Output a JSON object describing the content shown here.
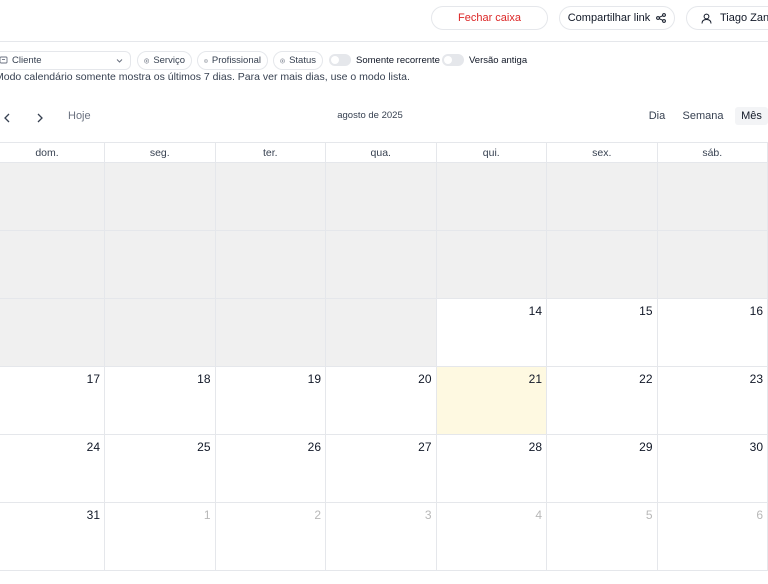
{
  "topbar": {
    "close_register": "Fechar caixa",
    "share_link": "Compartilhar link",
    "user_name": "Tiago Zanon"
  },
  "filters": {
    "client": "Cliente",
    "service": "Serviço",
    "professional": "Profissional",
    "status": "Status",
    "recurring_only": "Somente recorrente",
    "old_version": "Versão antiga"
  },
  "notice": "Modo calendário somente mostra os últimos 7 dias. Para ver mais dias, use o modo lista.",
  "nav": {
    "today": "Hoje",
    "month_title": "agosto de 2025",
    "views": [
      "Dia",
      "Semana",
      "Mês"
    ],
    "active_view": "Mês"
  },
  "calendar": {
    "weekdays": [
      "dom.",
      "seg.",
      "ter.",
      "qua.",
      "qui.",
      "sex.",
      "sáb."
    ],
    "weeks": [
      [
        {
          "n": "",
          "s": "disabled"
        },
        {
          "n": "",
          "s": "disabled"
        },
        {
          "n": "",
          "s": "disabled"
        },
        {
          "n": "",
          "s": "disabled"
        },
        {
          "n": "",
          "s": "disabled"
        },
        {
          "n": "",
          "s": "disabled"
        },
        {
          "n": "",
          "s": "disabled"
        }
      ],
      [
        {
          "n": "",
          "s": "disabled"
        },
        {
          "n": "",
          "s": "disabled"
        },
        {
          "n": "",
          "s": "disabled"
        },
        {
          "n": "",
          "s": "disabled"
        },
        {
          "n": "",
          "s": "disabled"
        },
        {
          "n": "",
          "s": "disabled"
        },
        {
          "n": "",
          "s": "disabled"
        }
      ],
      [
        {
          "n": "",
          "s": "disabled"
        },
        {
          "n": "",
          "s": "disabled"
        },
        {
          "n": "",
          "s": "disabled"
        },
        {
          "n": "",
          "s": "disabled"
        },
        {
          "n": "14",
          "s": ""
        },
        {
          "n": "15",
          "s": ""
        },
        {
          "n": "16",
          "s": ""
        }
      ],
      [
        {
          "n": "17",
          "s": ""
        },
        {
          "n": "18",
          "s": ""
        },
        {
          "n": "19",
          "s": ""
        },
        {
          "n": "20",
          "s": ""
        },
        {
          "n": "21",
          "s": "today"
        },
        {
          "n": "22",
          "s": ""
        },
        {
          "n": "23",
          "s": ""
        }
      ],
      [
        {
          "n": "24",
          "s": ""
        },
        {
          "n": "25",
          "s": ""
        },
        {
          "n": "26",
          "s": ""
        },
        {
          "n": "27",
          "s": ""
        },
        {
          "n": "28",
          "s": ""
        },
        {
          "n": "29",
          "s": ""
        },
        {
          "n": "30",
          "s": ""
        }
      ],
      [
        {
          "n": "31",
          "s": ""
        },
        {
          "n": "1",
          "s": "other"
        },
        {
          "n": "2",
          "s": "other"
        },
        {
          "n": "3",
          "s": "other"
        },
        {
          "n": "4",
          "s": "other"
        },
        {
          "n": "5",
          "s": "other"
        },
        {
          "n": "6",
          "s": "other"
        }
      ]
    ]
  },
  "colors": {
    "danger": "#dc2626",
    "today_bg": "#fef9e1",
    "disabled_bg": "#f0f0f0"
  }
}
